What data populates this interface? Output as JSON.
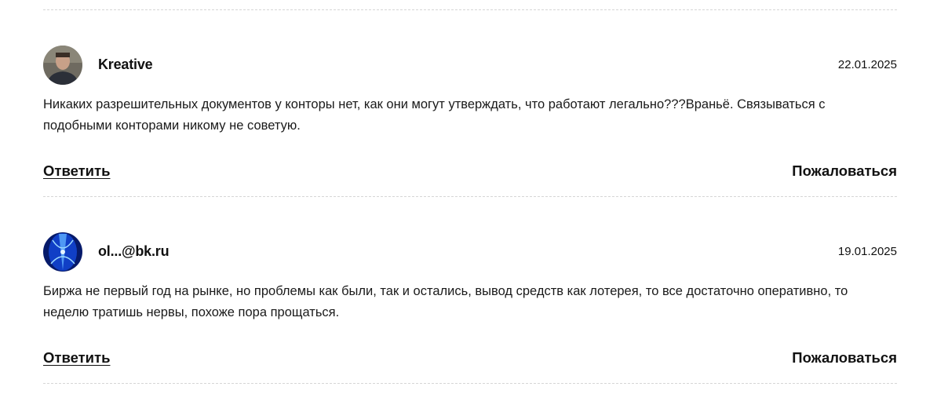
{
  "comments": [
    {
      "author": "Kreative",
      "date": "22.01.2025",
      "text": "Никаких разрешительных документов у конторы нет, как они могут утверждать, что работают легально???Враньё. Связываться с подобными конторами никому не советую.",
      "reply_label": "Ответить",
      "report_label": "Пожаловаться",
      "avatar_icon": "user-photo-avatar"
    },
    {
      "author": "ol...@bk.ru",
      "date": "19.01.2025",
      "text": "Биржа не первый год на рынке, но проблемы как были, так и остались, вывод средств как лотерея, то все достаточно оперативно, то неделю тратишь нервы, похоже пора прощаться.",
      "reply_label": "Ответить",
      "report_label": "Пожаловаться",
      "avatar_icon": "blue-abstract-avatar"
    }
  ]
}
